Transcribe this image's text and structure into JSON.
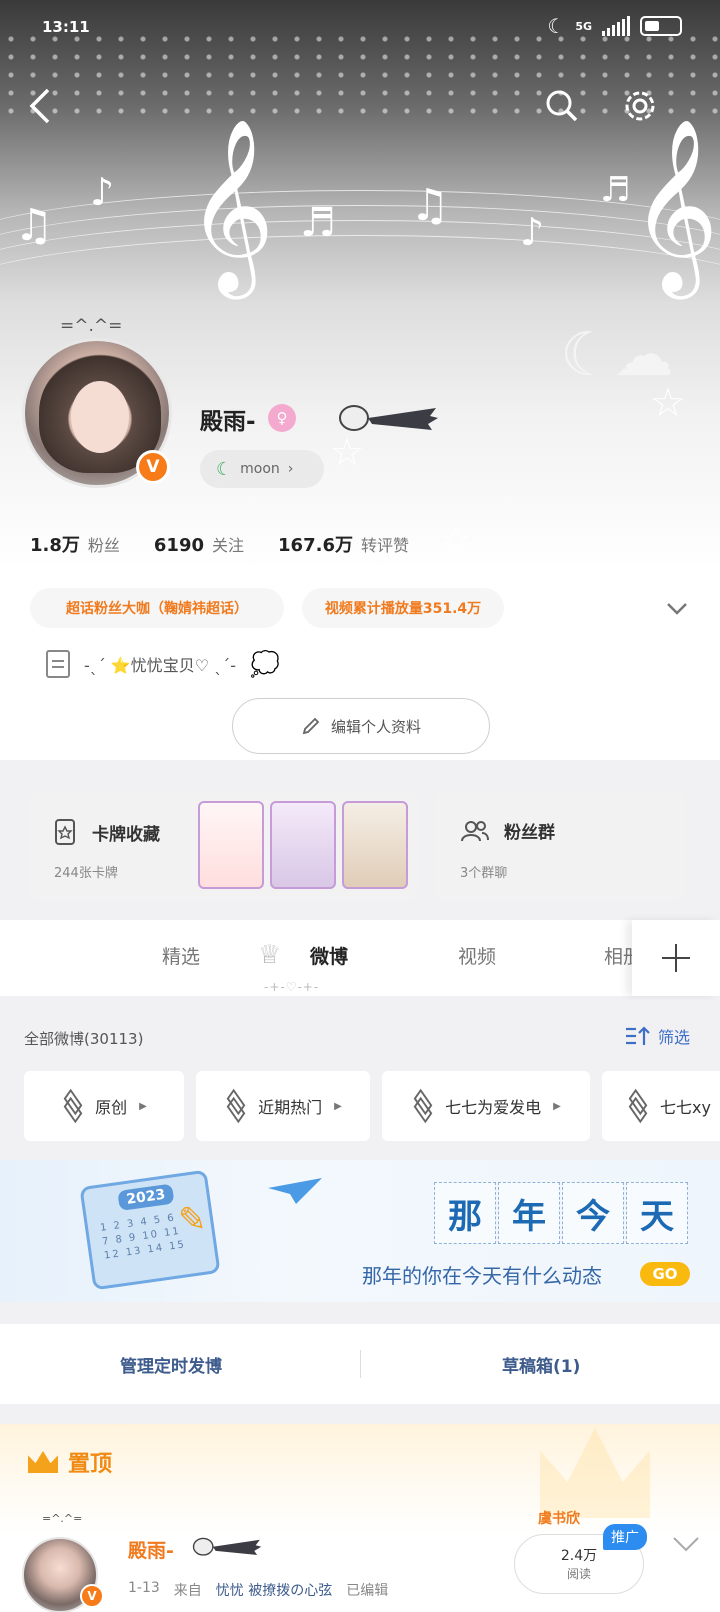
{
  "status_bar": {
    "time": "13:11",
    "network": "5G"
  },
  "profile": {
    "kaomoji": "=^.^=",
    "name": "殿雨-",
    "verified_badge": "V",
    "gender_icon": "female-icon",
    "moon_label": "moon",
    "stats": [
      {
        "value": "1.8万",
        "label": "粉丝"
      },
      {
        "value": "6190",
        "label": "关注"
      },
      {
        "value": "167.6万",
        "label": "转评赞"
      }
    ],
    "tags": [
      "超话粉丝大咖（鞠婧祎超话）",
      "视频累计播放量351.4万"
    ],
    "bio": "-ˎˊ ⭐忧忧宝贝♡ ˎˊ-",
    "edit_button": "编辑个人资料"
  },
  "cards": {
    "collection": {
      "title": "卡牌收藏",
      "subtitle": "244张卡牌"
    },
    "fan_group": {
      "title": "粉丝群",
      "subtitle": "3个群聊"
    }
  },
  "tabs": [
    {
      "label": "精选",
      "active": false
    },
    {
      "label": "微博",
      "active": true
    },
    {
      "label": "视频",
      "active": false
    },
    {
      "label": "相册",
      "active": false
    }
  ],
  "tab_decoration": "-+-♡-+-",
  "feed": {
    "all_label": "全部微博(30113)",
    "filter_label": "筛选",
    "chips": [
      "原创",
      "近期热门",
      "七七为爱发电",
      "七七xy"
    ]
  },
  "banner": {
    "year": "2023",
    "title_chars": [
      "那",
      "年",
      "今",
      "天"
    ],
    "subtitle": "那年的你在今天有什么动态",
    "go": "GO"
  },
  "actions": {
    "schedule": "管理定时发博",
    "drafts": "草稿箱(1)"
  },
  "pinned": {
    "title": "置顶",
    "kaomoji": "=^.^=",
    "author": "殿雨-",
    "date": "1-13",
    "from_label": "来自",
    "source": "忧忧 被撩拨の心弦",
    "edited": "已编辑",
    "reads_value": "2.4万",
    "reads_label": "阅读",
    "ad_badge": "推广",
    "ad_name": "虞书欣"
  },
  "colors": {
    "accent_orange": "#f07a1d",
    "link_blue": "#3d6fc7",
    "go_yellow": "#f9b90f"
  }
}
